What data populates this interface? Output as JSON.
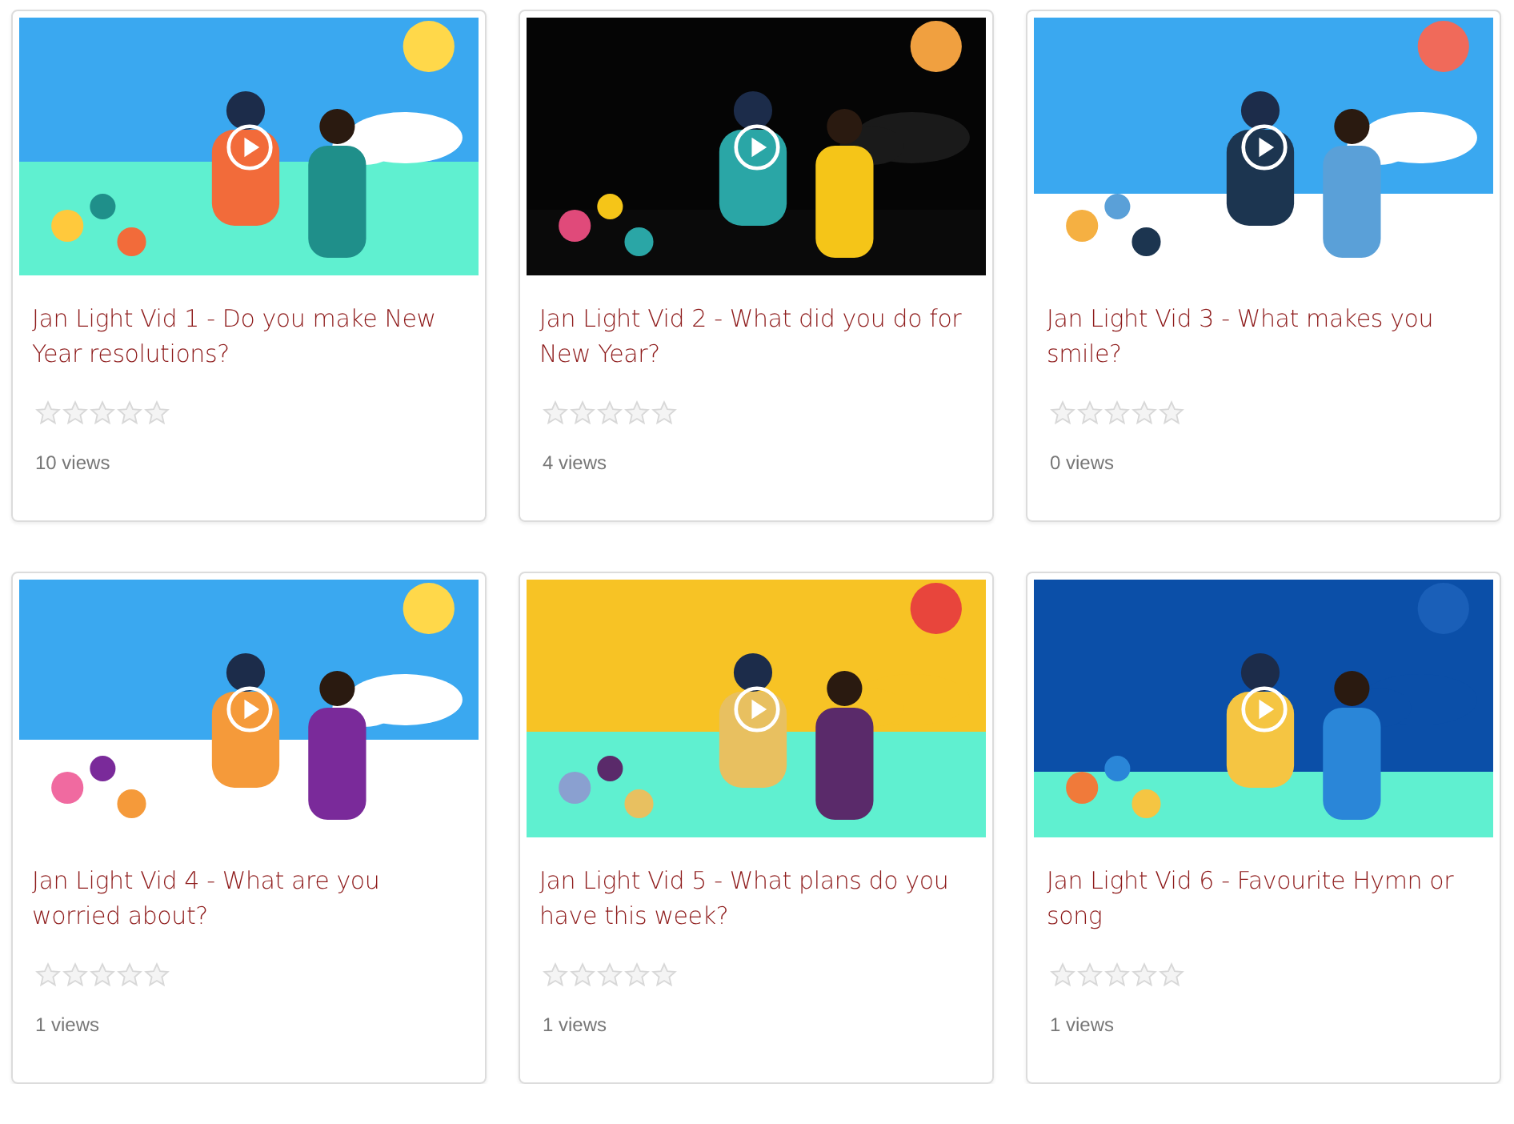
{
  "videos": [
    {
      "title": "Jan Light Vid 1 - Do you make New Year resolutions?",
      "stars": 0,
      "views": "10 views"
    },
    {
      "title": "Jan Light Vid 2 - What did you do for New Year?",
      "stars": 0,
      "views": "4 views"
    },
    {
      "title": "Jan Light Vid 3 - What makes you smile?",
      "stars": 0,
      "views": "0 views"
    },
    {
      "title": "Jan Light Vid 4 - What are you worried about?",
      "stars": 0,
      "views": "1 views"
    },
    {
      "title": "Jan Light Vid 5 - What plans do you have this week?",
      "stars": 0,
      "views": "1 views"
    },
    {
      "title": "Jan Light Vid 6 - Favourite Hymn or song",
      "stars": 0,
      "views": "1 views"
    }
  ]
}
